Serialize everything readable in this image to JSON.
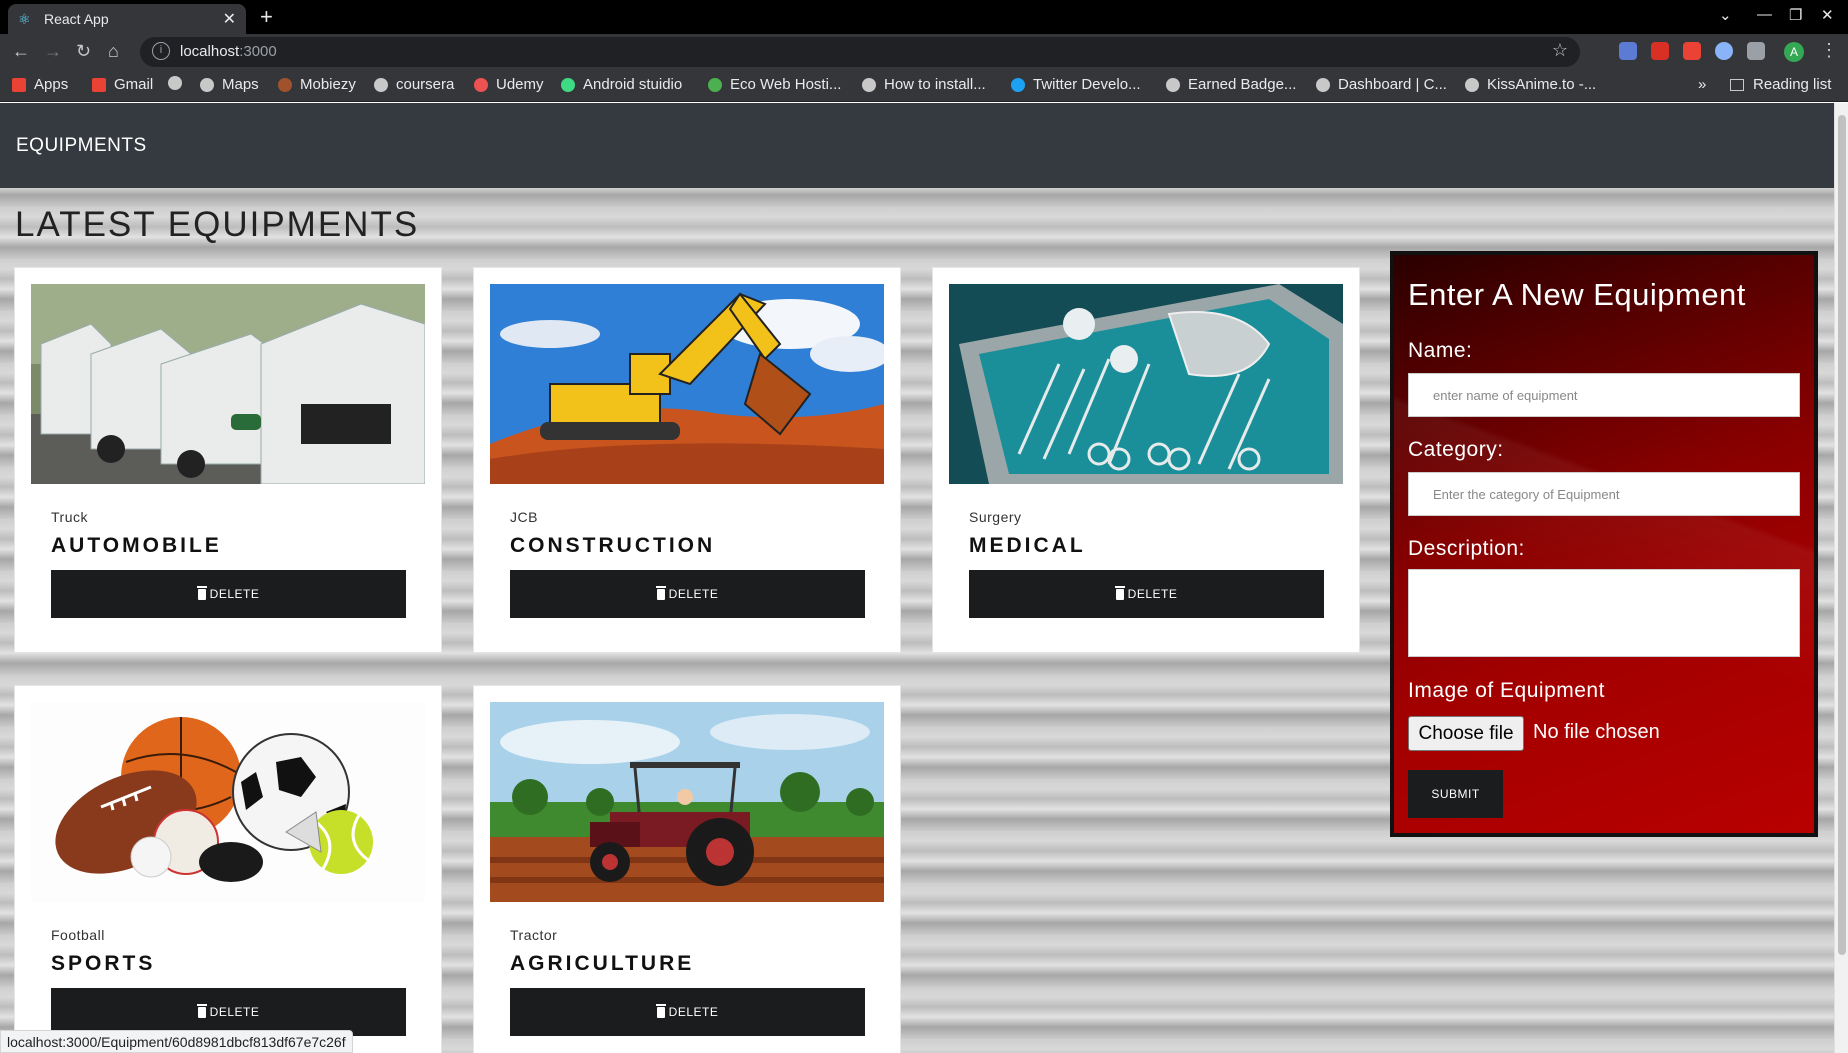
{
  "browser": {
    "tab_title": "React App",
    "url_host": "localhost",
    "url_port": ":3000",
    "avatar_letter": "A",
    "bookmarks": [
      {
        "label": "Apps"
      },
      {
        "label": "Gmail"
      },
      {
        "label": ""
      },
      {
        "label": "Maps"
      },
      {
        "label": "Mobiezy"
      },
      {
        "label": "coursera"
      },
      {
        "label": "Udemy"
      },
      {
        "label": "Android stuidio"
      },
      {
        "label": "Eco Web Hosti..."
      },
      {
        "label": "How to install..."
      },
      {
        "label": "Twitter Develo..."
      },
      {
        "label": "Earned Badge..."
      },
      {
        "label": "Dashboard | C..."
      },
      {
        "label": "KissAnime.to -..."
      }
    ],
    "more_label": "»",
    "reading_list": "Reading list",
    "status_url": "localhost:3000/Equipment/60d8981dbcf813df67e7c26f"
  },
  "app": {
    "brand": "EQUIPMENTS",
    "heading": "LATEST EQUIPMENTS",
    "delete_label": "DELETE",
    "cards": [
      {
        "name": "Truck",
        "category": "AUTOMOBILE"
      },
      {
        "name": "JCB",
        "category": "CONSTRUCTION"
      },
      {
        "name": "Surgery",
        "category": "MEDICAL"
      },
      {
        "name": "Football",
        "category": "SPORTS"
      },
      {
        "name": "Tractor",
        "category": "AGRICULTURE"
      }
    ]
  },
  "form": {
    "title": "Enter A New Equipment",
    "name_label": "Name:",
    "name_placeholder": "enter name of equipment",
    "category_label": "Category:",
    "category_placeholder": "Enter the category of Equipment",
    "description_label": "Description:",
    "image_label": "Image of Equipment",
    "file_button": "Choose file",
    "file_status": "No file chosen",
    "submit_label": "SUBMIT"
  },
  "colors": {
    "navbar": "#343a40",
    "button": "#1b1c1d",
    "form_red": "#b80000"
  }
}
